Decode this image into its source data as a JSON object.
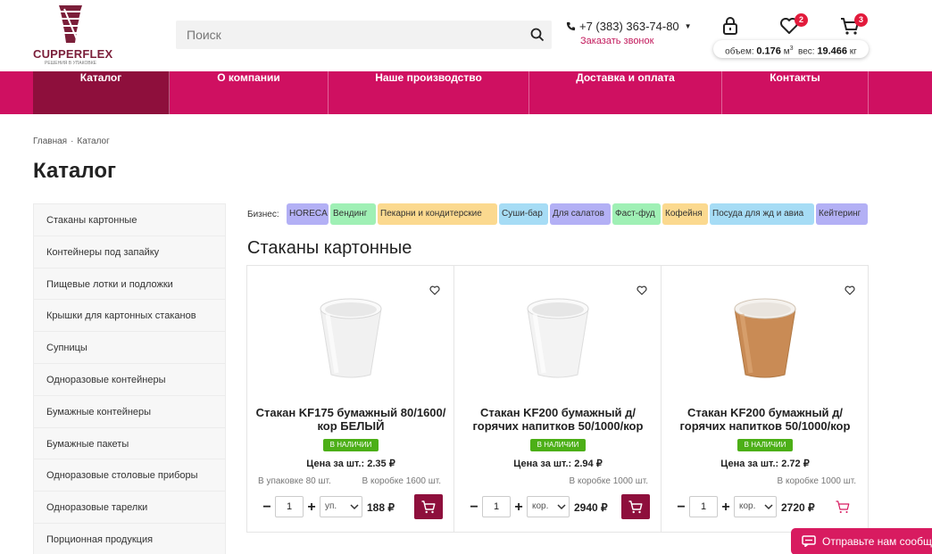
{
  "brand": {
    "name": "CUPPERFLEX",
    "tagline": "РЕШЕНИЯ В УПАКОВКЕ"
  },
  "search": {
    "placeholder": "Поиск"
  },
  "contact": {
    "phone": "+7 (383) 363-74-80",
    "callback": "Заказать звонок"
  },
  "header": {
    "wishlist_count": "2",
    "cart_count": "3",
    "volume_label": "объем:",
    "volume_value": "0.176",
    "volume_unit": "м",
    "volume_sup": "3",
    "weight_label": "вес:",
    "weight_value": "19.466",
    "weight_unit": "кг"
  },
  "nav": [
    "Каталог",
    "О компании",
    "Наше производство",
    "Доставка и оплата",
    "Контакты"
  ],
  "breadcrumb": [
    "Главная",
    "Каталог"
  ],
  "page_title": "Каталог",
  "sidebar": [
    "Стаканы картонные",
    "Контейнеры под запайку",
    "Пищевые лотки и подложки",
    "Крышки для картонных стаканов",
    "Супницы",
    "Одноразовые контейнеры",
    "Бумажные контейнеры",
    "Бумажные пакеты",
    "Одноразовые столовые приборы",
    "Одноразовые тарелки",
    "Порционная продукция"
  ],
  "business": {
    "label": "Бизнес:",
    "tags": [
      {
        "label": "HORECA",
        "color": "#b3b0f5"
      },
      {
        "label": "Вендинг",
        "color": "#9ff0b5"
      },
      {
        "label": "Пекарни и кондитерские",
        "color": "#fbd98f"
      },
      {
        "label": "Суши-бар",
        "color": "#a6dcf5"
      },
      {
        "label": "Для салатов",
        "color": "#b3b0f5"
      },
      {
        "label": "Фаст-фуд",
        "color": "#9ff0b5"
      },
      {
        "label": "Кофейня",
        "color": "#fbd98f"
      },
      {
        "label": "Посуда для жд и авиа",
        "color": "#a6dcf5"
      },
      {
        "label": "Кейтеринг",
        "color": "#b3b0f5"
      }
    ]
  },
  "section_title": "Стаканы картонные",
  "products": [
    {
      "name": "Стакан KF175 бумажный 80/1600/кор БЕЛЫЙ",
      "stock": "В НАЛИЧИИ",
      "price": "Цена за шт.: 2.35 ₽",
      "pack": "В упаковке 80 шт.",
      "box": "В коробке 1600 шт.",
      "qty": "1",
      "unit": "уп.",
      "sum": "188 ₽",
      "cup_color": "white",
      "cart_filled": true
    },
    {
      "name": "Стакан KF200 бумажный д/горячих напитков 50/1000/кор",
      "stock": "В НАЛИЧИИ",
      "price": "Цена за шт.: 2.94 ₽",
      "pack": "",
      "box": "В коробке 1000 шт.",
      "qty": "1",
      "unit": "кор.",
      "sum": "2940 ₽",
      "cup_color": "white",
      "cart_filled": true
    },
    {
      "name": "Стакан KF200 бумажный д/горячих напитков 50/1000/кор",
      "stock": "В НАЛИЧИИ",
      "price": "Цена за шт.: 2.72 ₽",
      "pack": "",
      "box": "В коробке 1000 шт.",
      "qty": "1",
      "unit": "кор.",
      "sum": "2720 ₽",
      "cup_color": "kraft",
      "cart_filled": false
    }
  ],
  "chat": {
    "label": "Отправьте нам сообщ"
  },
  "colors": {
    "brand_pink": "#cf1061",
    "nav_active": "#8e0f3c",
    "in_stock": "#4caf17",
    "badge": "#e21b3c"
  }
}
